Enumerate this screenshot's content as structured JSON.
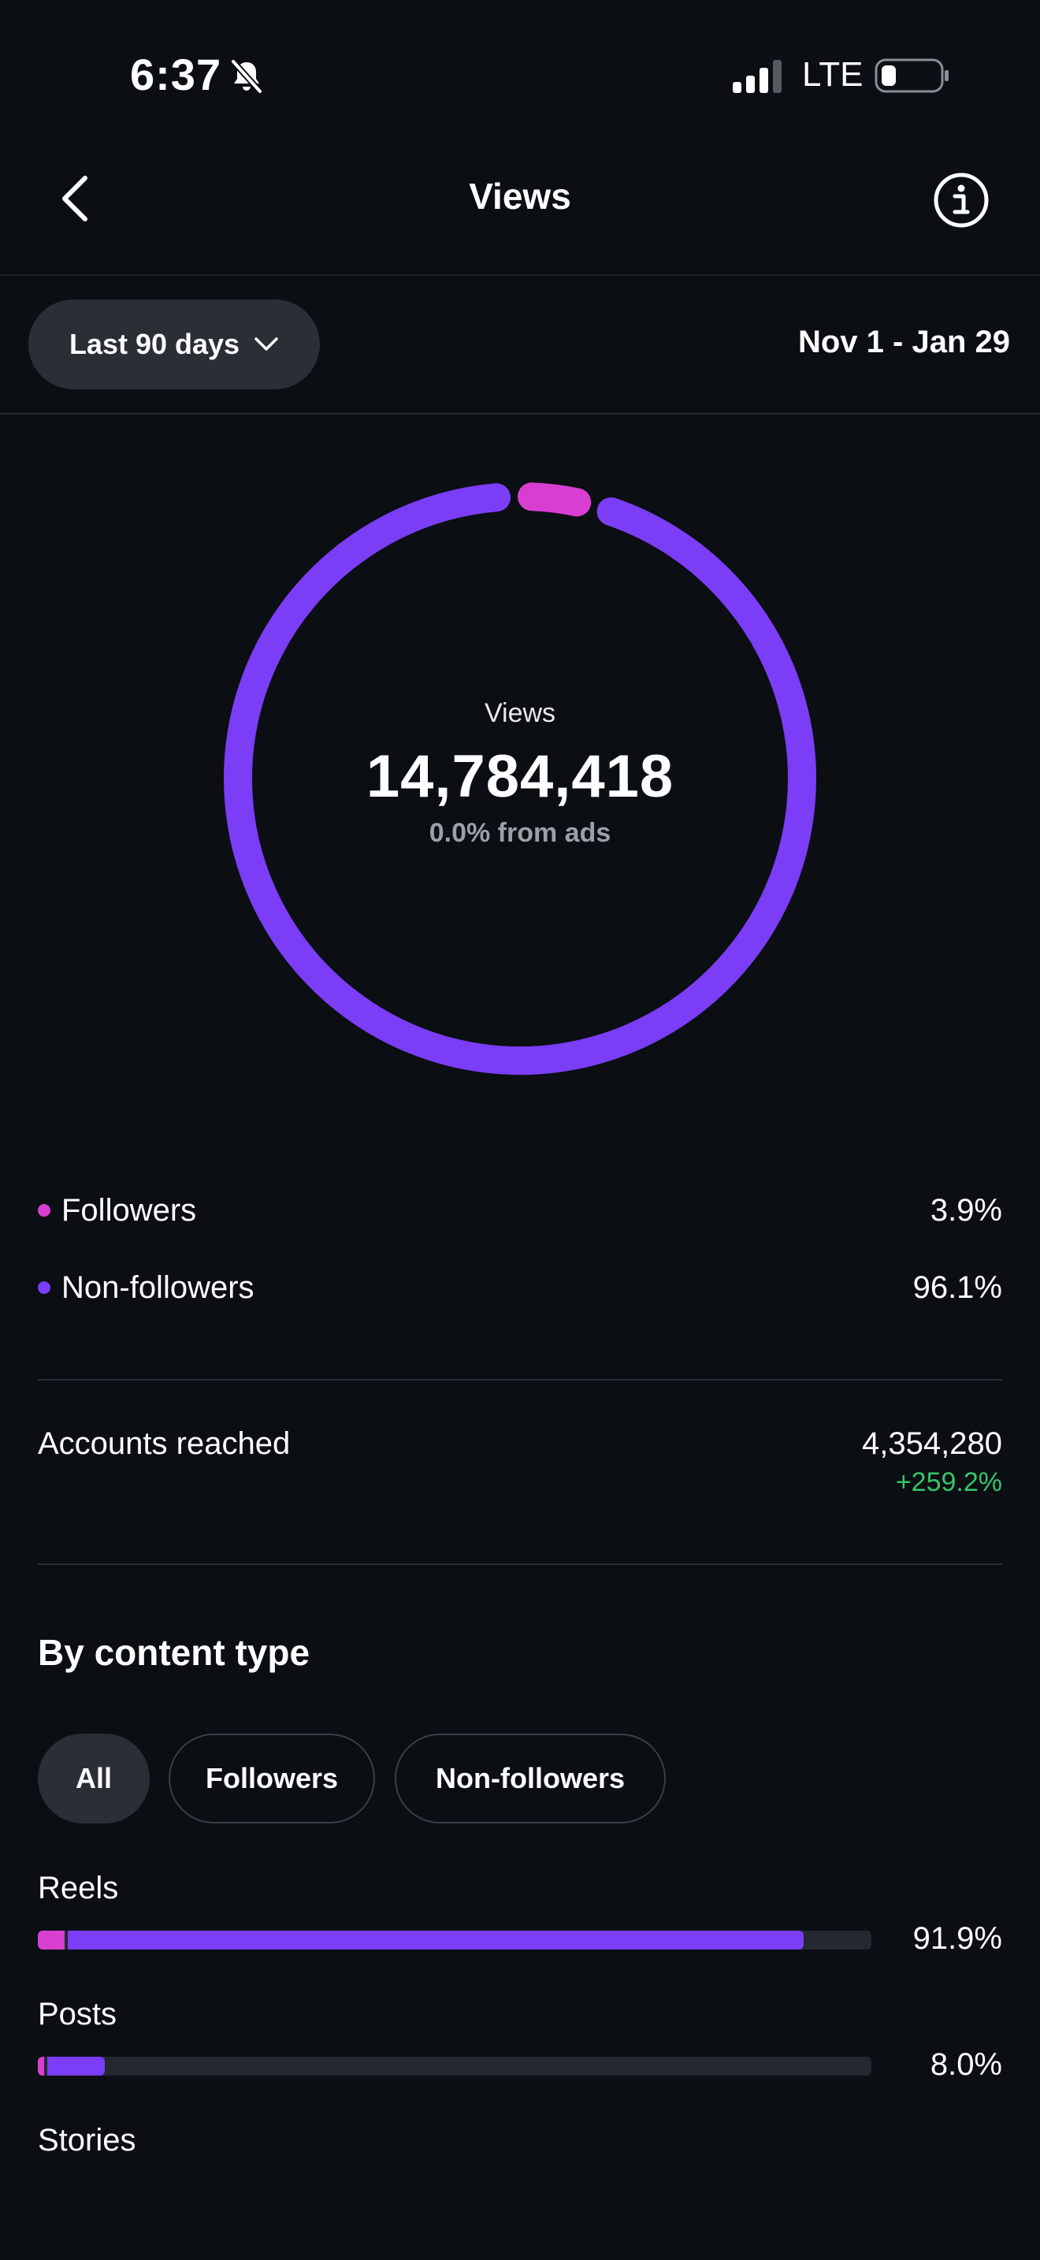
{
  "status_bar": {
    "time": "6:37",
    "network": "LTE"
  },
  "header": {
    "title": "Views"
  },
  "range": {
    "selector_label": "Last 90 days",
    "dates": "Nov 1 - Jan 29"
  },
  "summary": {
    "label": "Views",
    "value": "14,784,418",
    "ads_note": "0.0% from ads"
  },
  "colors": {
    "followers": "#d83fd0",
    "non_followers": "#7b3df5",
    "positive": "#35c46a"
  },
  "audience": [
    {
      "label": "Followers",
      "percent": "3.9%",
      "share": 3.9
    },
    {
      "label": "Non-followers",
      "percent": "96.1%",
      "share": 96.1
    }
  ],
  "accounts_reached": {
    "label": "Accounts reached",
    "value": "4,354,280",
    "change": "+259.2%"
  },
  "content_type": {
    "title": "By content type",
    "filters": [
      "All",
      "Followers",
      "Non-followers"
    ],
    "items": [
      {
        "label": "Reels",
        "percent": "91.9%",
        "total": 91.9,
        "followers": 3.2
      },
      {
        "label": "Posts",
        "percent": "8.0%",
        "total": 8.0,
        "followers": 0.8
      },
      {
        "label": "Stories"
      }
    ]
  }
}
